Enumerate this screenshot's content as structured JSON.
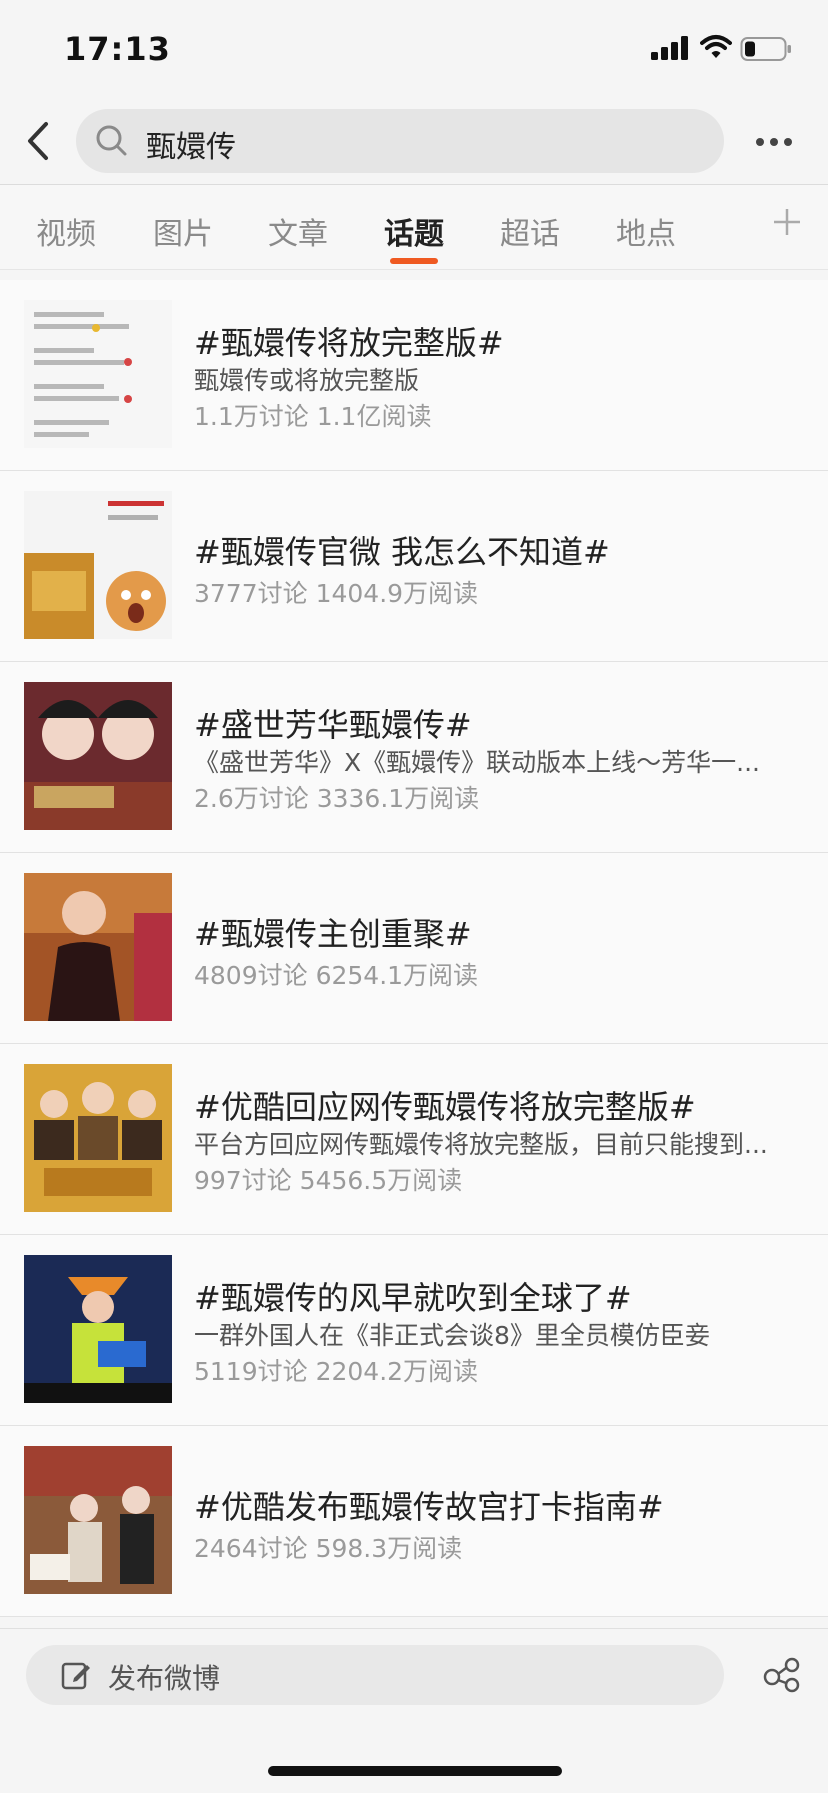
{
  "status": {
    "time": "17:13"
  },
  "search": {
    "query": "甄嬛传"
  },
  "tabs": [
    {
      "label": "视频"
    },
    {
      "label": "图片"
    },
    {
      "label": "文章"
    },
    {
      "label": "话题"
    },
    {
      "label": "超话"
    },
    {
      "label": "地点"
    }
  ],
  "active_tab": "话题",
  "topics": [
    {
      "title": "#甄嬛传将放完整版#",
      "desc": "甄嬛传或将放完整版",
      "stats": "1.1万讨论 1.1亿阅读",
      "thumb_colors": [
        "#f0f0f0",
        "#d64545"
      ]
    },
    {
      "title": "#甄嬛传官微 我怎么不知道#",
      "desc": "",
      "stats": "3777讨论 1404.9万阅读",
      "thumb_colors": [
        "#f2f2f2",
        "#c98b2a"
      ]
    },
    {
      "title": "#盛世芳华甄嬛传#",
      "desc": "《盛世芳华》X《甄嬛传》联动版本上线～芳华一...",
      "stats": "2.6万讨论 3336.1万阅读",
      "thumb_colors": [
        "#6b2a2e",
        "#c9a560"
      ]
    },
    {
      "title": "#甄嬛传主创重聚#",
      "desc": "",
      "stats": "4809讨论 6254.1万阅读",
      "thumb_colors": [
        "#7a3b1a",
        "#c77a3a"
      ]
    },
    {
      "title": "#优酷回应网传甄嬛传将放完整版#",
      "desc": "平台方回应网传甄嬛传将放完整版，目前只能搜到...",
      "stats": "997讨论 5456.5万阅读",
      "thumb_colors": [
        "#d9a438",
        "#3c2a1e"
      ]
    },
    {
      "title": "#甄嬛传的风早就吹到全球了#",
      "desc": "一群外国人在《非正式会谈8》里全员模仿臣妾",
      "stats": "5119讨论 2204.2万阅读",
      "thumb_colors": [
        "#1b2a55",
        "#c6e23a"
      ]
    },
    {
      "title": "#优酷发布甄嬛传故宫打卡指南#",
      "desc": "",
      "stats": "2464讨论 598.3万阅读",
      "thumb_colors": [
        "#8b5a3a",
        "#e0d6c8"
      ]
    }
  ],
  "bottom": {
    "post_label": "发布微博"
  },
  "colors": {
    "accent": "#ef5a22",
    "text": "#222222",
    "muted": "#9a9a9a"
  }
}
